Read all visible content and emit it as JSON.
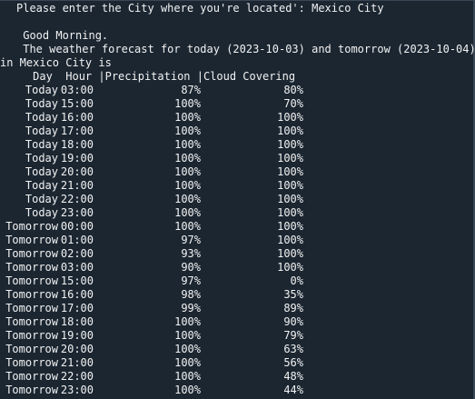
{
  "prompt_line": "Please enter the City where you're located': Mexico City",
  "greeting": " Good Morning.",
  "forecast_intro_1": " The weather forecast for today (2023-10-03) and tomorrow (2023-10-04)",
  "forecast_intro_2": "in Mexico City is",
  "header": "     Day  Hour |Precipitation |Cloud Covering",
  "rows": [
    {
      "day": "Today",
      "hour": "03:00",
      "precipitation": "87%",
      "cloud": "80%"
    },
    {
      "day": "Today",
      "hour": "15:00",
      "precipitation": "100%",
      "cloud": "70%"
    },
    {
      "day": "Today",
      "hour": "16:00",
      "precipitation": "100%",
      "cloud": "100%"
    },
    {
      "day": "Today",
      "hour": "17:00",
      "precipitation": "100%",
      "cloud": "100%"
    },
    {
      "day": "Today",
      "hour": "18:00",
      "precipitation": "100%",
      "cloud": "100%"
    },
    {
      "day": "Today",
      "hour": "19:00",
      "precipitation": "100%",
      "cloud": "100%"
    },
    {
      "day": "Today",
      "hour": "20:00",
      "precipitation": "100%",
      "cloud": "100%"
    },
    {
      "day": "Today",
      "hour": "21:00",
      "precipitation": "100%",
      "cloud": "100%"
    },
    {
      "day": "Today",
      "hour": "22:00",
      "precipitation": "100%",
      "cloud": "100%"
    },
    {
      "day": "Today",
      "hour": "23:00",
      "precipitation": "100%",
      "cloud": "100%"
    },
    {
      "day": "Tomorrow",
      "hour": "00:00",
      "precipitation": "100%",
      "cloud": "100%"
    },
    {
      "day": "Tomorrow",
      "hour": "01:00",
      "precipitation": "97%",
      "cloud": "100%"
    },
    {
      "day": "Tomorrow",
      "hour": "02:00",
      "precipitation": "93%",
      "cloud": "100%"
    },
    {
      "day": "Tomorrow",
      "hour": "03:00",
      "precipitation": "90%",
      "cloud": "100%"
    },
    {
      "day": "Tomorrow",
      "hour": "15:00",
      "precipitation": "97%",
      "cloud": "0%"
    },
    {
      "day": "Tomorrow",
      "hour": "16:00",
      "precipitation": "98%",
      "cloud": "35%"
    },
    {
      "day": "Tomorrow",
      "hour": "17:00",
      "precipitation": "99%",
      "cloud": "89%"
    },
    {
      "day": "Tomorrow",
      "hour": "18:00",
      "precipitation": "100%",
      "cloud": "90%"
    },
    {
      "day": "Tomorrow",
      "hour": "19:00",
      "precipitation": "100%",
      "cloud": "79%"
    },
    {
      "day": "Tomorrow",
      "hour": "20:00",
      "precipitation": "100%",
      "cloud": "63%"
    },
    {
      "day": "Tomorrow",
      "hour": "21:00",
      "precipitation": "100%",
      "cloud": "56%"
    },
    {
      "day": "Tomorrow",
      "hour": "22:00",
      "precipitation": "100%",
      "cloud": "48%"
    },
    {
      "day": "Tomorrow",
      "hour": "23:00",
      "precipitation": "100%",
      "cloud": "44%"
    }
  ],
  "colors": {
    "background": "#1b2631",
    "text": "#f2f2f2"
  }
}
